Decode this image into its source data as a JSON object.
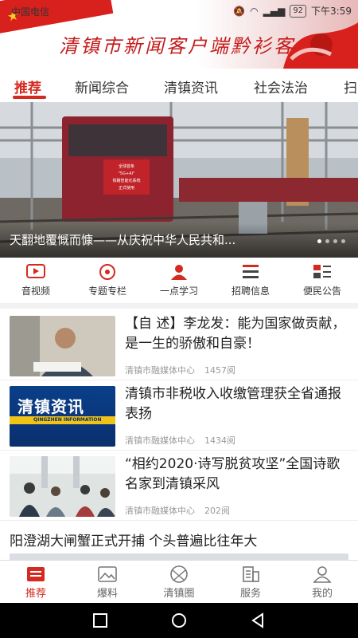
{
  "status_bar": {
    "carrier": "中国电信",
    "battery": "92",
    "time": "下午3:59"
  },
  "header": {
    "title": "清镇市新闻客户端黔衫客"
  },
  "tabs": [
    {
      "label": "推荐"
    },
    {
      "label": "新闻综合"
    },
    {
      "label": "清镇资讯"
    },
    {
      "label": "社会法治"
    },
    {
      "label": "扫"
    }
  ],
  "banner": {
    "caption": "天翻地覆慨而慷——从庆祝中华人民共和...",
    "sign_lines": [
      "全球首条",
      "\"5G+AI\"",
      "铁路智能化系统",
      "正式使用"
    ]
  },
  "categories": [
    {
      "label": "音视频",
      "icon": "play-icon"
    },
    {
      "label": "专题专栏",
      "icon": "target-icon"
    },
    {
      "label": "一点学习",
      "icon": "person-icon"
    },
    {
      "label": "招聘信息",
      "icon": "list-icon"
    },
    {
      "label": "便民公告",
      "icon": "notice-icon"
    }
  ],
  "news": [
    {
      "title": "【自 述】李龙发：能为国家做贡献，是一生的骄傲和自豪！",
      "source": "清镇市融媒体中心",
      "reads": "1457阅"
    },
    {
      "title": "清镇市非税收入收缴管理获全省通报表扬",
      "source": "清镇市融媒体中心",
      "reads": "1434阅",
      "thumb_text": "清镇资讯",
      "thumb_sub": "QINGZHEN INFORMATION"
    },
    {
      "title": "“相约2020·诗写脱贫攻坚”全国诗歌名家到清镇采风",
      "source": "清镇市融媒体中心",
      "reads": "202阅"
    }
  ],
  "plain_news": {
    "title": "阳澄湖大闸蟹正式开捕 个头普遍比往年大"
  },
  "bottom_nav": [
    {
      "label": "推荐",
      "icon": "home-list-icon"
    },
    {
      "label": "爆料",
      "icon": "image-icon"
    },
    {
      "label": "清镇圈",
      "icon": "circle-icon"
    },
    {
      "label": "服务",
      "icon": "building-icon"
    },
    {
      "label": "我的",
      "icon": "user-icon"
    }
  ],
  "colors": {
    "accent": "#d42a20",
    "header_red": "#c41b1b",
    "meta": "#999999"
  }
}
